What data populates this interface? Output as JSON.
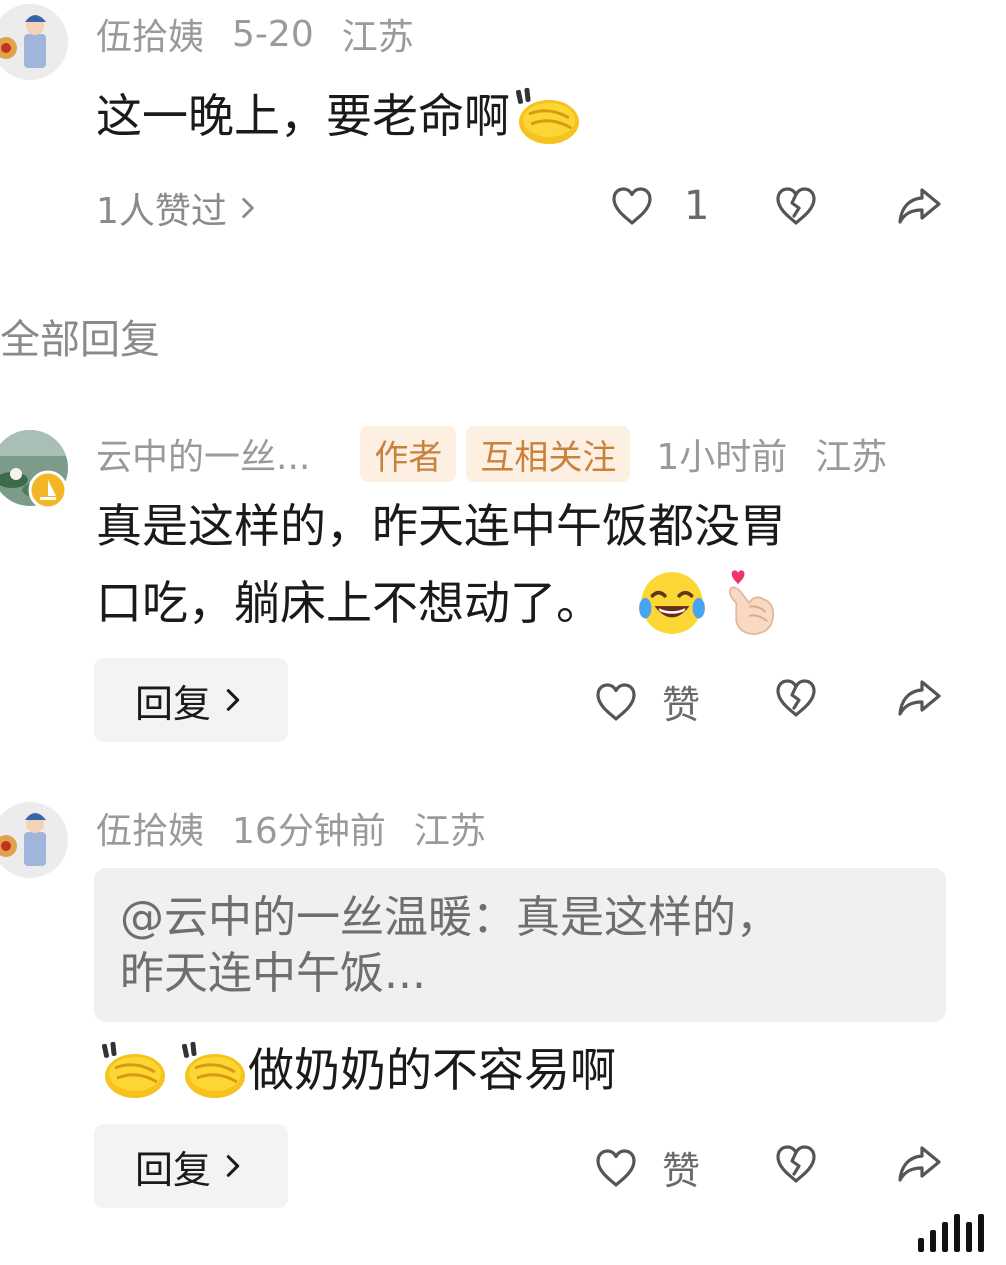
{
  "comment1": {
    "user": "伍拾姨",
    "date": "5-20",
    "location": "江苏",
    "text": "这一晚上，要老命啊",
    "emoji": "clap-hands-emoji",
    "liked_by": "1人赞过",
    "like_count": "1"
  },
  "section_title": "全部回复",
  "reply1": {
    "user": "云中的一丝...",
    "tags": [
      "作者",
      "互相关注"
    ],
    "time": "1小时前",
    "location": "江苏",
    "line1": "真是这样的，昨天连中午饭都没胃",
    "line2": "口吃，躺床上不想动了。",
    "emojis": [
      "tears-of-joy-emoji",
      "finger-heart-emoji"
    ],
    "reply_label": "回复",
    "like_label": "赞"
  },
  "reply2": {
    "user": "伍拾姨",
    "time": "16分钟前",
    "location": "江苏",
    "quote_line1": "@云中的一丝温暖：真是这样的，",
    "quote_line2": "昨天连中午饭...",
    "text": "做奶奶的不容易啊",
    "emojis": [
      "clap-hands-emoji",
      "clap-hands-emoji"
    ],
    "reply_label": "回复",
    "like_label": "赞"
  },
  "colors": {
    "meta": "#9a9a9a",
    "tag_bg": "#fdf0e3",
    "tag_text": "#c9823c",
    "button_bg": "#f3f3f3"
  }
}
